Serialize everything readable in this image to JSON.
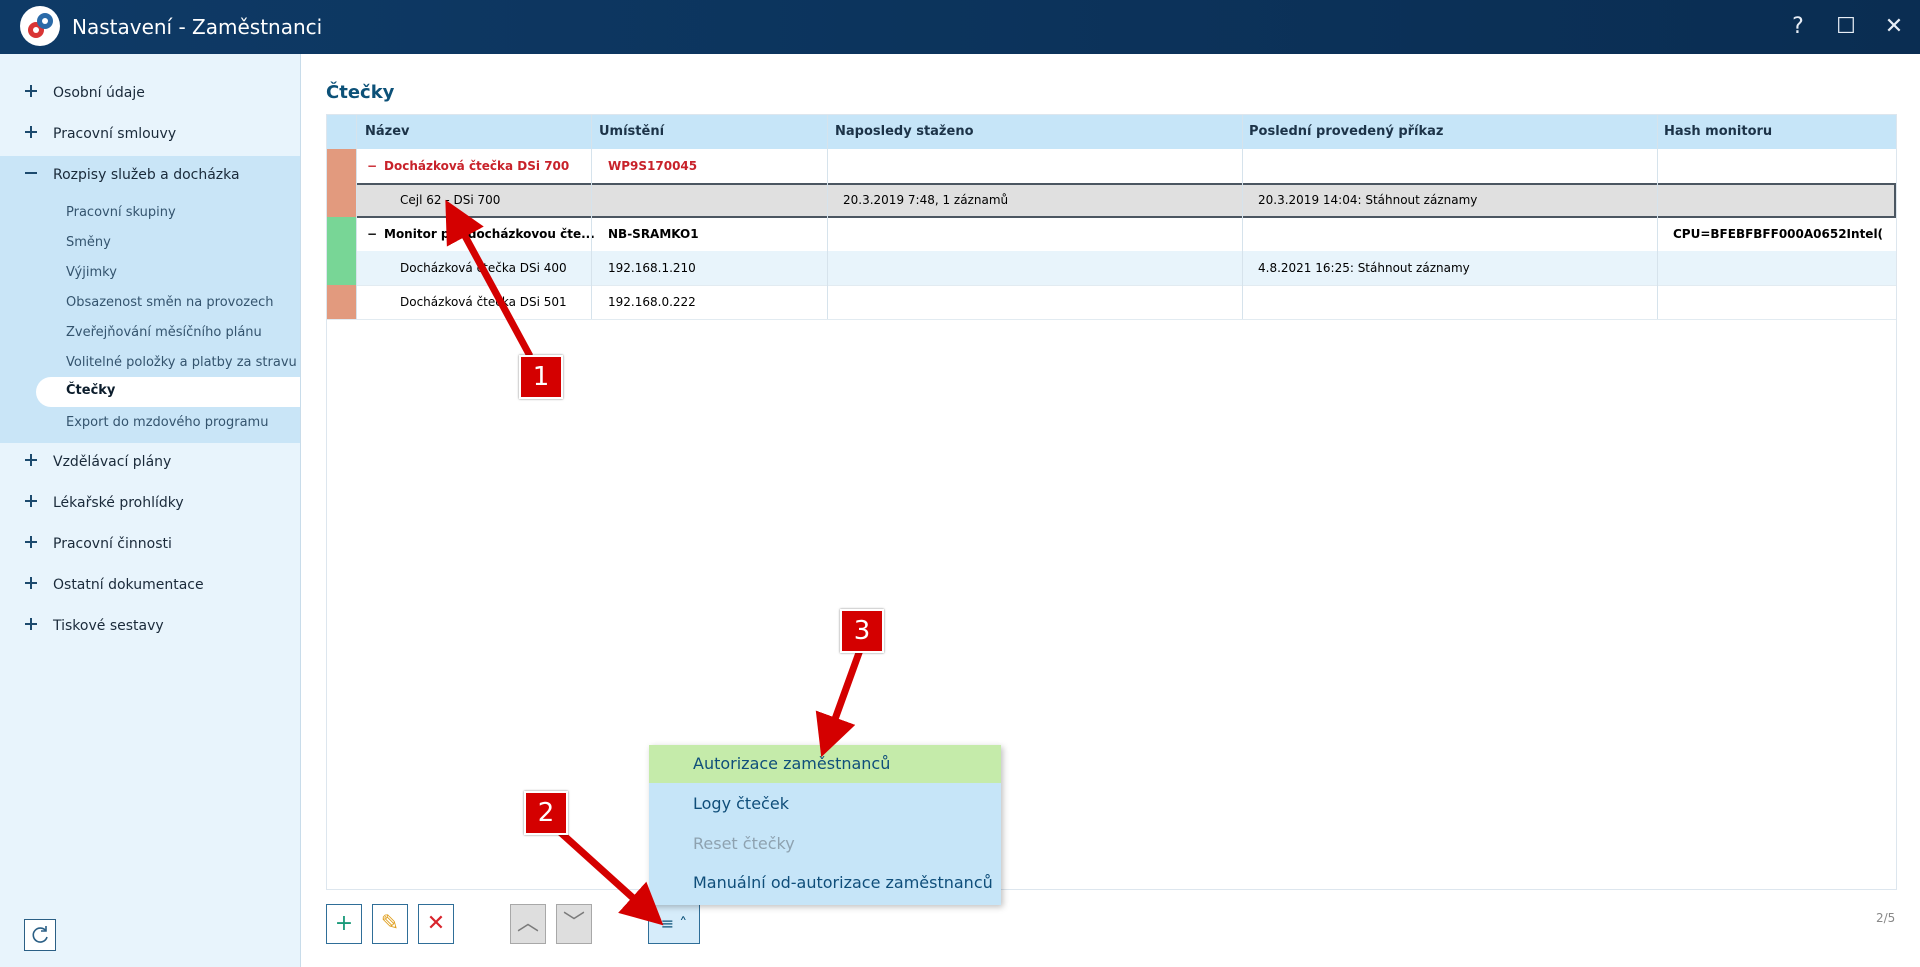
{
  "window": {
    "title": "Nastavení - Zaměstnanci",
    "help_glyph": "?",
    "maximize_glyph": "☐",
    "close_glyph": "✕"
  },
  "sidebar": {
    "groups": [
      {
        "label": "Osobní údaje",
        "state": "+"
      },
      {
        "label": "Pracovní smlouvy",
        "state": "+"
      },
      {
        "label": "Rozpisy služeb a docházka",
        "state": "−"
      },
      {
        "label": "Vzdělávací plány",
        "state": "+"
      },
      {
        "label": "Lékařské prohlídky",
        "state": "+"
      },
      {
        "label": "Pracovní činnosti",
        "state": "+"
      },
      {
        "label": "Ostatní dokumentace",
        "state": "+"
      },
      {
        "label": "Tiskové sestavy",
        "state": "+"
      }
    ],
    "subitems": [
      "Pracovní skupiny",
      "Směny",
      "Výjimky",
      "Obsazenost směn na provozech",
      "Zveřejňování měsíčního plánu",
      "Volitelné položky a platby za stravu",
      "Čtečky",
      "Export do mzdového programu"
    ],
    "active_subitem": "Čtečky"
  },
  "main": {
    "title": "Čtečky",
    "columns": [
      "Název",
      "Umístění",
      "Naposledy staženo",
      "Poslední provedený příkaz",
      "Hash monitoru"
    ],
    "rows": [
      {
        "name": "Docházková čtečka DSi 700",
        "location": "WP9S170045",
        "last_download": "",
        "last_command": "",
        "hash": "",
        "group": true,
        "status_color": "#e29a7e",
        "text_color": "#c8222a"
      },
      {
        "name": "Cejl 62 - DSi 700",
        "location": "",
        "last_download": "20.3.2019 7:48, 1 záznamů",
        "last_command": "20.3.2019 14:04: Stáhnout záznamy",
        "hash": "",
        "group": false,
        "status_color": "#e29a7e"
      },
      {
        "name": "Monitor pro docházkovou čte...",
        "location": "NB-SRAMKO1",
        "last_download": "",
        "last_command": "",
        "hash": "CPU=BFEBFBFF000A0652Intel(...",
        "group": true,
        "status_color": "#78d696"
      },
      {
        "name": "Docházková čtečka DSi 400",
        "location": "192.168.1.210",
        "last_download": "",
        "last_command": "4.8.2021 16:25: Stáhnout záznamy",
        "hash": "",
        "group": false,
        "status_color": "#78d696"
      },
      {
        "name": "Docházková čtečka DSi 501",
        "location": "192.168.0.222",
        "last_download": "",
        "last_command": "",
        "hash": "",
        "group": false,
        "status_color": "#e29a7e"
      }
    ],
    "group_toggle": "−"
  },
  "toolbar": {
    "add_glyph": "+",
    "edit_glyph": "✎",
    "delete_glyph": "✕",
    "up_glyph": "︿",
    "down_glyph": "﹀",
    "menu_glyph": "≡ ˄",
    "pager": "2/5"
  },
  "popup_menu": {
    "items": [
      {
        "label": "Autorizace zaměstnanců",
        "state": "highlighted"
      },
      {
        "label": "Logy čteček",
        "state": "normal"
      },
      {
        "label": "Reset čtečky",
        "state": "disabled"
      },
      {
        "label": "Manuální od-autorizace zaměstnanců",
        "state": "normal"
      }
    ]
  },
  "annotations": {
    "badge1": "1",
    "badge2": "2",
    "badge3": "3",
    "color": "#d40000"
  },
  "colors": {
    "titlebar": "#0e3a66",
    "accent": "#0c5178",
    "header": "#c6e5f8",
    "sidebar_expanded": "#c9e5f7"
  }
}
